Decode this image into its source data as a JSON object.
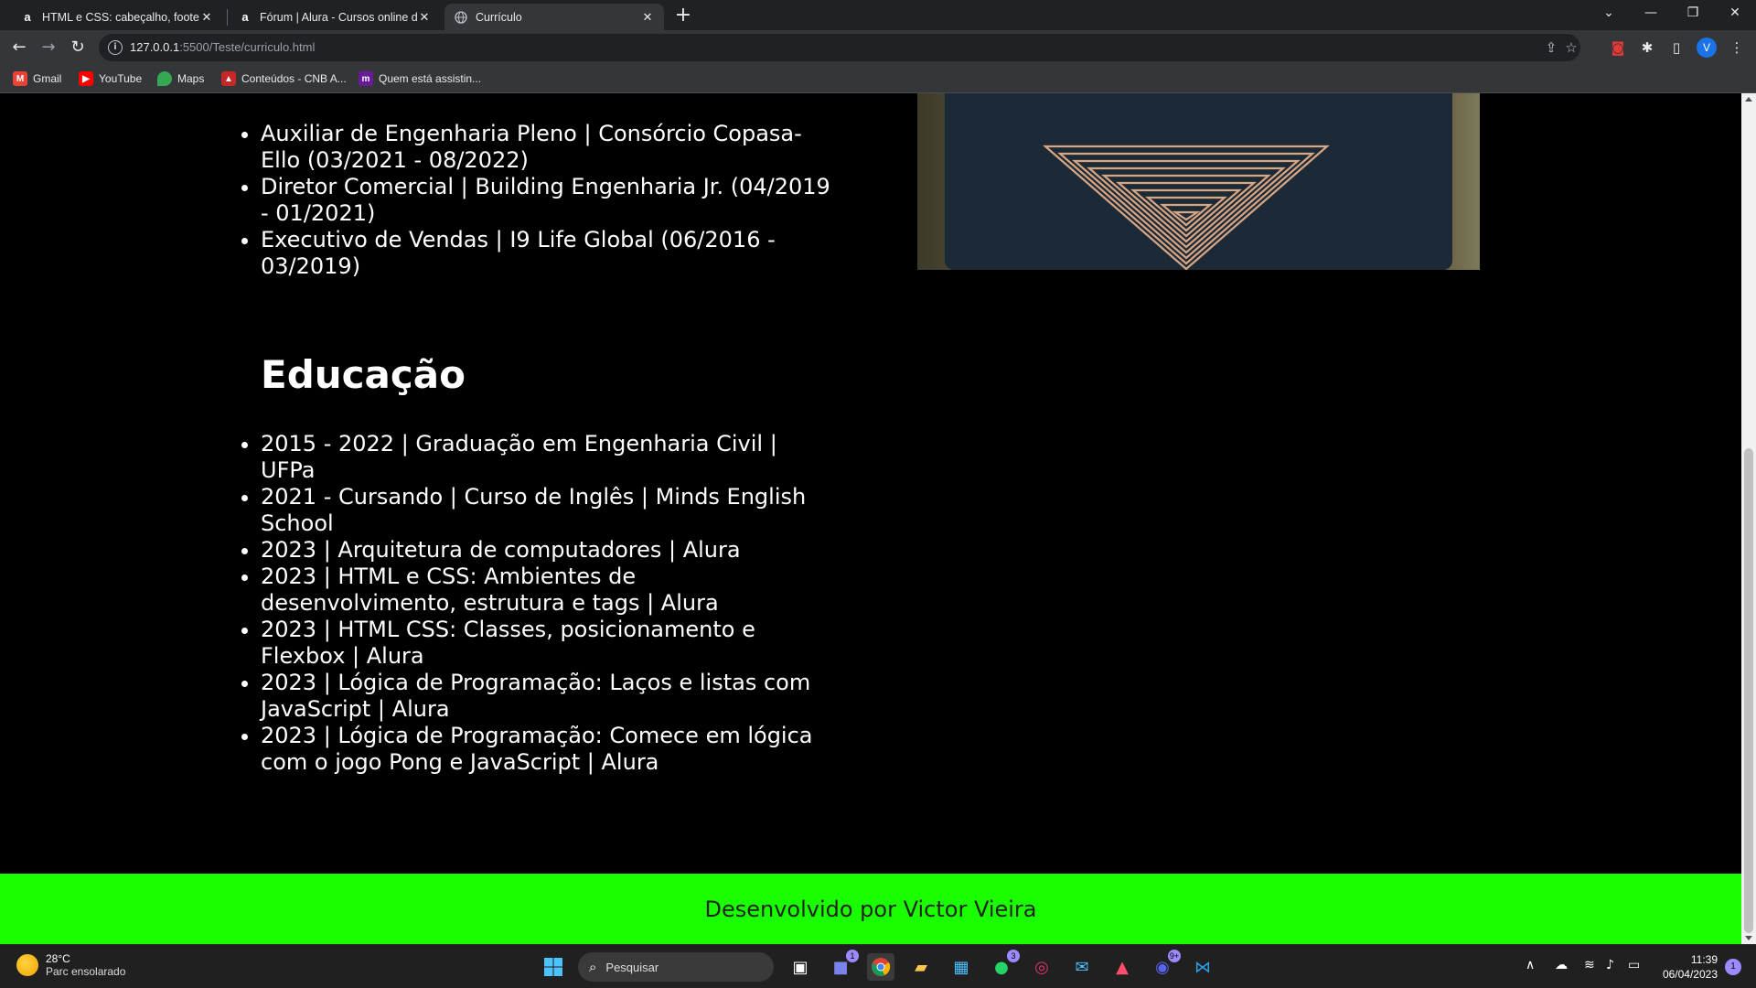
{
  "browser": {
    "tabs": [
      {
        "title": "HTML e CSS: cabeçalho, footer e",
        "favicon": "a",
        "active": false
      },
      {
        "title": "Fórum | Alura - Cursos online de",
        "favicon": "a",
        "active": false
      },
      {
        "title": "Currículo",
        "favicon": "globe-icon",
        "active": true
      }
    ],
    "url_host": "127.0.0.1",
    "url_rest": ":5500/Teste/curriculo.html",
    "bookmarks": [
      {
        "label": "Gmail",
        "icon": "gmail-icon",
        "color": "#ea4335"
      },
      {
        "label": "YouTube",
        "icon": "youtube-icon",
        "color": "#ff0000"
      },
      {
        "label": "Maps",
        "icon": "maps-icon",
        "color": "#34a853"
      },
      {
        "label": "Conteúdos - CNB A...",
        "icon": "cnb-icon",
        "color": "#c62828"
      },
      {
        "label": "Quem está assistin...",
        "icon": "m-icon",
        "color": "#6a1b9a"
      }
    ],
    "profile_initial": "V"
  },
  "page": {
    "experience": [
      "Auxiliar de Engenharia Pleno | Consórcio Copasa-Ello (03/2021 - 08/2022)",
      "Diretor Comercial | Building Engenharia Jr. (04/2019 - 01/2021)",
      "Executivo de Vendas | I9 Life Global (06/2016 - 03/2019)"
    ],
    "education_title": "Educação",
    "education": [
      "2015 - 2022 | Graduação em Engenharia Civil | UFPa",
      "2021 - Cursando | Curso de Inglês | Minds English School",
      "2023 | Arquitetura de computadores | Alura",
      "2023 | HTML e CSS: Ambientes de desenvolvimento, estrutura e tags | Alura",
      "2023 | HTML CSS: Classes, posicionamento e Flexbox | Alura",
      "2023 | Lógica de Programação: Laços e listas com JavaScript | Alura",
      "2023 | Lógica de Programação: Comece em lógica com o jogo Pong e JavaScript | Alura"
    ],
    "footer_text": "Desenvolvido por Victor Vieira",
    "footer_color": "#1aff00"
  },
  "taskbar": {
    "weather_temp": "28°C",
    "weather_desc": "Parc ensolarado",
    "search_placeholder": "Pesquisar",
    "time": "11:39",
    "date": "06/04/2023",
    "badges": {
      "teams": "1",
      "whatsapp": "3",
      "discord": "9+"
    },
    "notifications": "1"
  }
}
